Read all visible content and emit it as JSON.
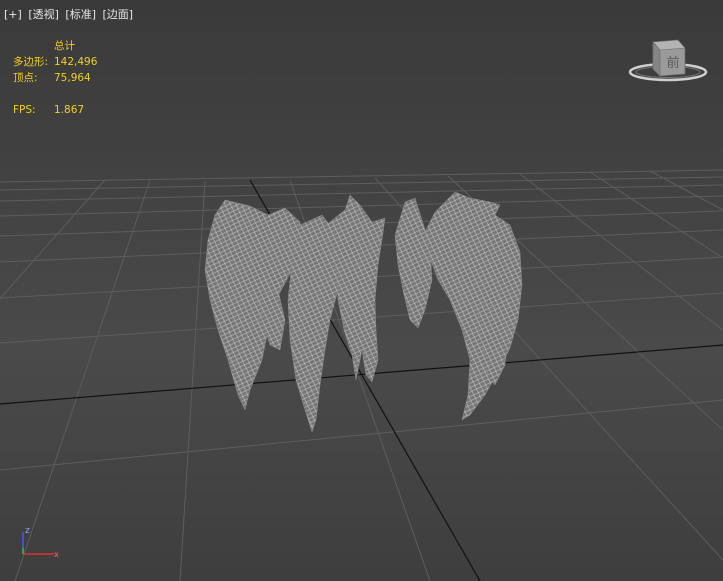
{
  "viewport": {
    "menu": [
      {
        "label": "[+]"
      },
      {
        "label": "[透视]"
      },
      {
        "label": "[标准]"
      },
      {
        "label": "[边面]"
      }
    ],
    "stats": {
      "header": "总计",
      "polygons_label": "多边形:",
      "polygons_value": "142,496",
      "vertices_label": "顶点:",
      "vertices_value": "75,964",
      "fps_label": "FPS:",
      "fps_value": "1.867"
    },
    "viewcube": {
      "face_label": "前"
    },
    "axis": {
      "z_label": "z",
      "x_label": "x"
    }
  },
  "colors": {
    "stats_text": "#f0d21e",
    "menu_text": "#e6e6e6",
    "grid_line": "#5e5e5e",
    "grid_axis": "#111111",
    "mesh_fill": "#7a7a7a",
    "mesh_wire": "#e8e8e8",
    "axis_z": "#3c5cff",
    "axis_x": "#e03030"
  }
}
